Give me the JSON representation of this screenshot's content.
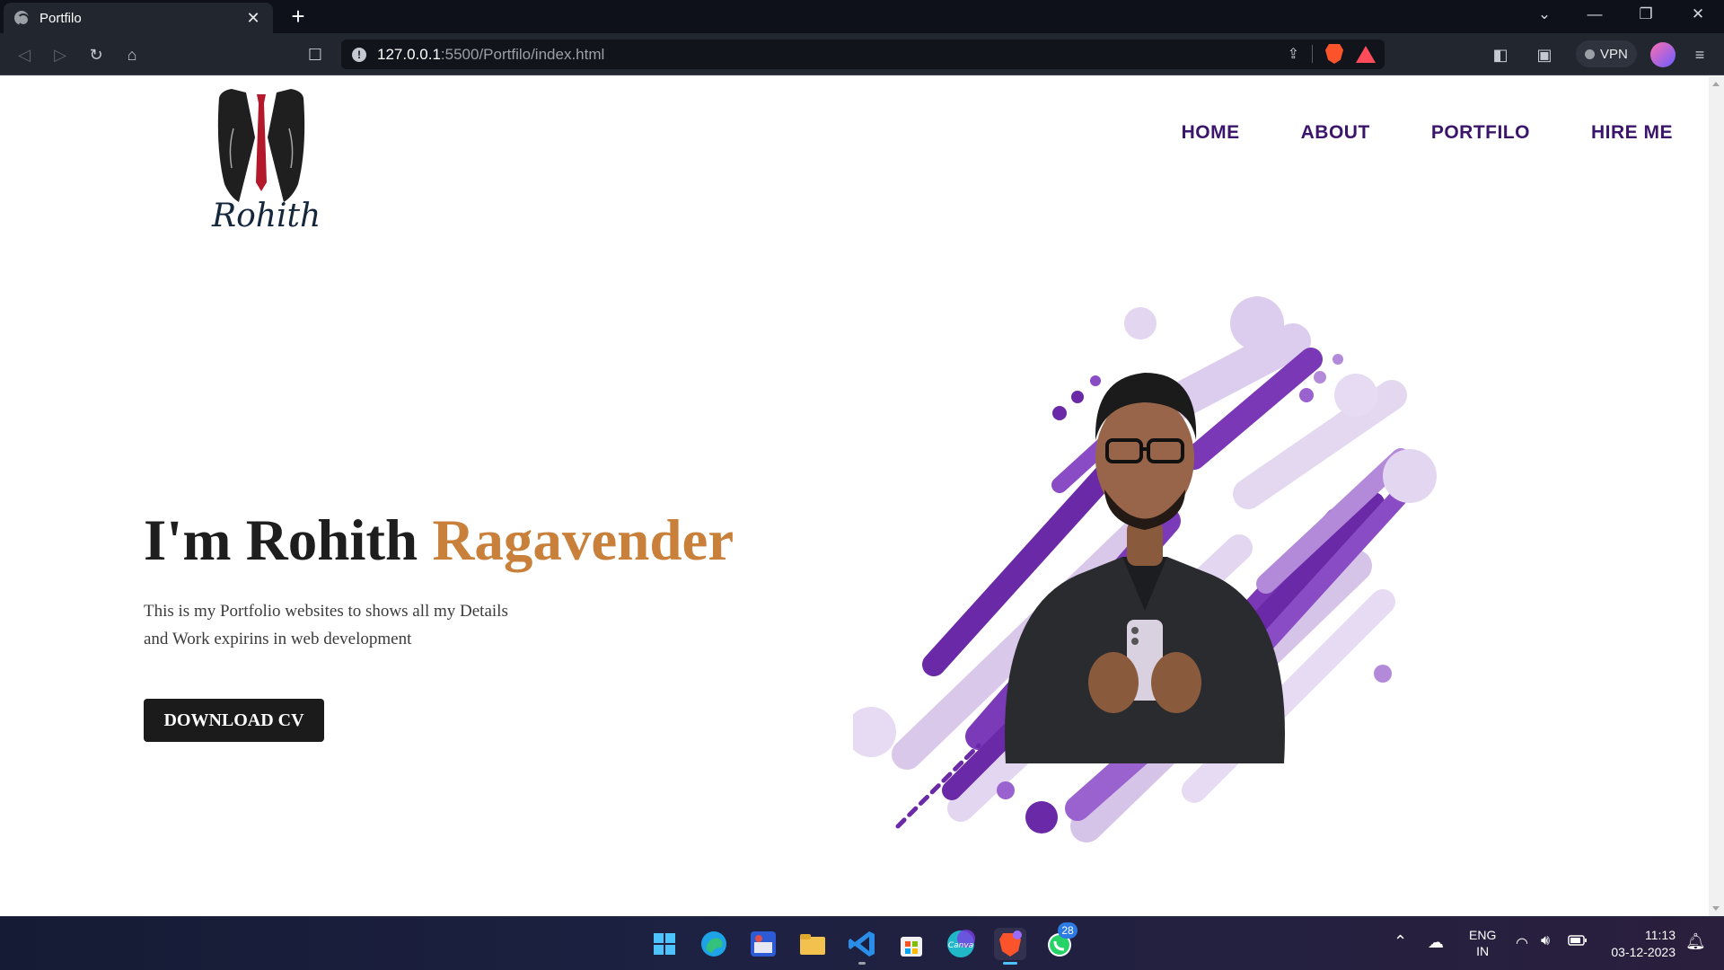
{
  "browser": {
    "tab_title": "Portfilo",
    "url_host": "127.0.0.1",
    "url_path": ":5500/Portfilo/index.html",
    "vpn_label": "VPN"
  },
  "site": {
    "logo_text": "Rohith",
    "nav": [
      "HOME",
      "ABOUT",
      "PORTFILO",
      "HIRE ME"
    ],
    "hero": {
      "title_main": "I'm Rohith ",
      "title_accent": "Ragavender",
      "description": "This is my Portfolio websites to shows all my Details and Work expirins in web development",
      "cta_label": "DOWNLOAD CV"
    },
    "colors": {
      "nav": "#3b146b",
      "accent": "#c9803b",
      "button_bg": "#1b1b1b",
      "art_purple": "#6a2aa7"
    }
  },
  "taskbar": {
    "apps": [
      "windows-start-icon",
      "edge-icon",
      "game-icon",
      "file-explorer-icon",
      "vscode-icon",
      "store-icon",
      "canva-icon",
      "brave-icon",
      "whatsapp-icon"
    ],
    "canva_label": "Canva",
    "whatsapp_badge": "28",
    "language": "ENG",
    "region": "IN",
    "time": "11:13",
    "date": "03-12-2023"
  }
}
